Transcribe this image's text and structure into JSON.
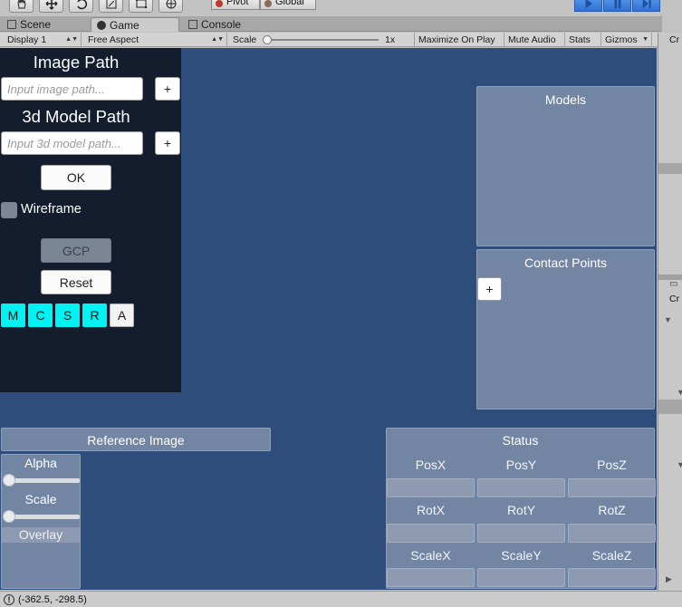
{
  "toolbar": {
    "tools": [
      "hand-tool",
      "move-tool",
      "rotate-tool",
      "scale-tool",
      "rect-tool",
      "transform-tool"
    ],
    "pivot_label": "Pivot",
    "global_label": "Global"
  },
  "tabs": [
    {
      "label": "Scene"
    },
    {
      "label": "Game"
    },
    {
      "label": "Console"
    }
  ],
  "game_toolbar": {
    "display": "Display 1",
    "aspect": "Free Aspect",
    "scale_label": "Scale",
    "scale_value": "1x",
    "maximize": "Maximize On Play",
    "mute": "Mute Audio",
    "stats": "Stats",
    "gizmos": "Gizmos"
  },
  "right_panel": {
    "label_top": "Cr",
    "label_mid": "Cr"
  },
  "left_panel": {
    "image_path_title": "Image Path",
    "image_path_placeholder": "Input image path...",
    "model_path_title": "3d Model Path",
    "model_path_placeholder": "Input 3d model path...",
    "plus": "+",
    "ok": "OK",
    "wireframe": "Wireframe",
    "gcp": "GCP",
    "reset": "Reset",
    "modes": [
      "M",
      "C",
      "S",
      "R",
      "A"
    ]
  },
  "models_panel": {
    "title": "Models"
  },
  "contact_panel": {
    "title": "Contact Points",
    "plus": "+"
  },
  "reference_panel": {
    "title": "Reference Image",
    "alpha": "Alpha",
    "scale": "Scale",
    "overlay": "Overlay"
  },
  "status_panel": {
    "title": "Status",
    "labels": [
      "PosX",
      "PosY",
      "PosZ",
      "RotX",
      "RotY",
      "RotZ",
      "ScaleX",
      "ScaleY",
      "ScaleZ"
    ]
  },
  "status_bar": {
    "coords": "(-362.5, -298.5)"
  },
  "colors": {
    "game_bg": "#2e4d7a",
    "left_panel_bg": "#131d2e",
    "mode_active": "#00f3f3",
    "panel_bg": "#7286a4"
  }
}
